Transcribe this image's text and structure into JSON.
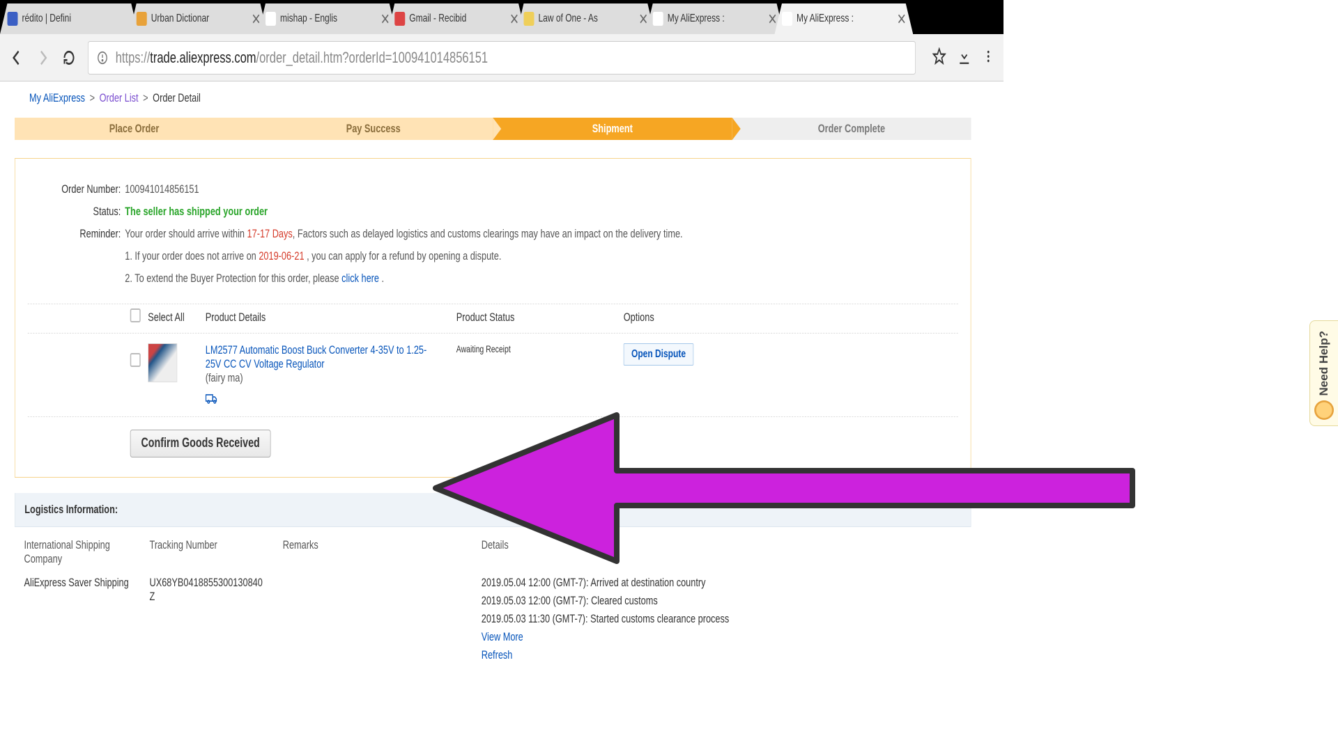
{
  "browser": {
    "tabs": [
      {
        "title": "rédito | Defini"
      },
      {
        "title": "Urban Dictionar"
      },
      {
        "title": "mishap - Englis"
      },
      {
        "title": "Gmail - Recibid"
      },
      {
        "title": "Law of One - As"
      },
      {
        "title": "My AliExpress :"
      },
      {
        "title": "My AliExpress :",
        "active": true
      }
    ],
    "url_prefix": "https://",
    "url_host": "trade.aliexpress.com",
    "url_path": "/order_detail.htm?orderId=100941014856151"
  },
  "breadcrumb": {
    "root": "My AliExpress",
    "list": "Order List",
    "current": "Order Detail"
  },
  "progress": {
    "s1": "Place Order",
    "s2": "Pay Success",
    "s3": "Shipment",
    "s4": "Order Complete"
  },
  "order": {
    "labels": {
      "number": "Order Number:",
      "status": "Status:",
      "reminder": "Reminder:"
    },
    "number": "100941014856151",
    "status": "The seller has shipped your order",
    "reminder_pre": "Your order should arrive within ",
    "reminder_days": "17-17 Days",
    "reminder_post": ", Factors such as delayed logistics and customs clearings may have an impact on the delivery time.",
    "reminder_l2_pre": "1. If your order does not arrive on ",
    "reminder_l2_date": "2019-06-21",
    "reminder_l2_post": " , you can apply for a refund by opening a dispute.",
    "reminder_l3_pre": "2. To extend the Buyer Protection for this order, please ",
    "reminder_l3_link": "click here",
    "reminder_l3_post": " ."
  },
  "items": {
    "head_selectall": "Select All",
    "head_details": "Product Details",
    "head_status": "Product Status",
    "head_options": "Options",
    "product_name": "LM2577 Automatic Boost Buck Converter 4-35V to 1.25-25V CC CV Voltage Regulator",
    "seller": "(fairy ma)",
    "status": "Awaiting Receipt",
    "open_dispute": "Open Dispute",
    "confirm": "Confirm Goods Received"
  },
  "logistics": {
    "heading": "Logistics Information:",
    "cols": {
      "c1": "International Shipping Company",
      "c2": "Tracking Number",
      "c3": "Remarks",
      "c4": "Details"
    },
    "company": "AliExpress Saver Shipping",
    "tracking": "UX68YB0418855300130840Z",
    "detail1": "2019.05.04 12:00 (GMT-7): Arrived at destination country",
    "detail2": "2019.05.03 12:00 (GMT-7): Cleared customs",
    "detail3": "2019.05.03 11:30 (GMT-7): Started customs clearance process",
    "view_more": "View More",
    "refresh": "Refresh"
  },
  "help_tab": "Need Help?"
}
